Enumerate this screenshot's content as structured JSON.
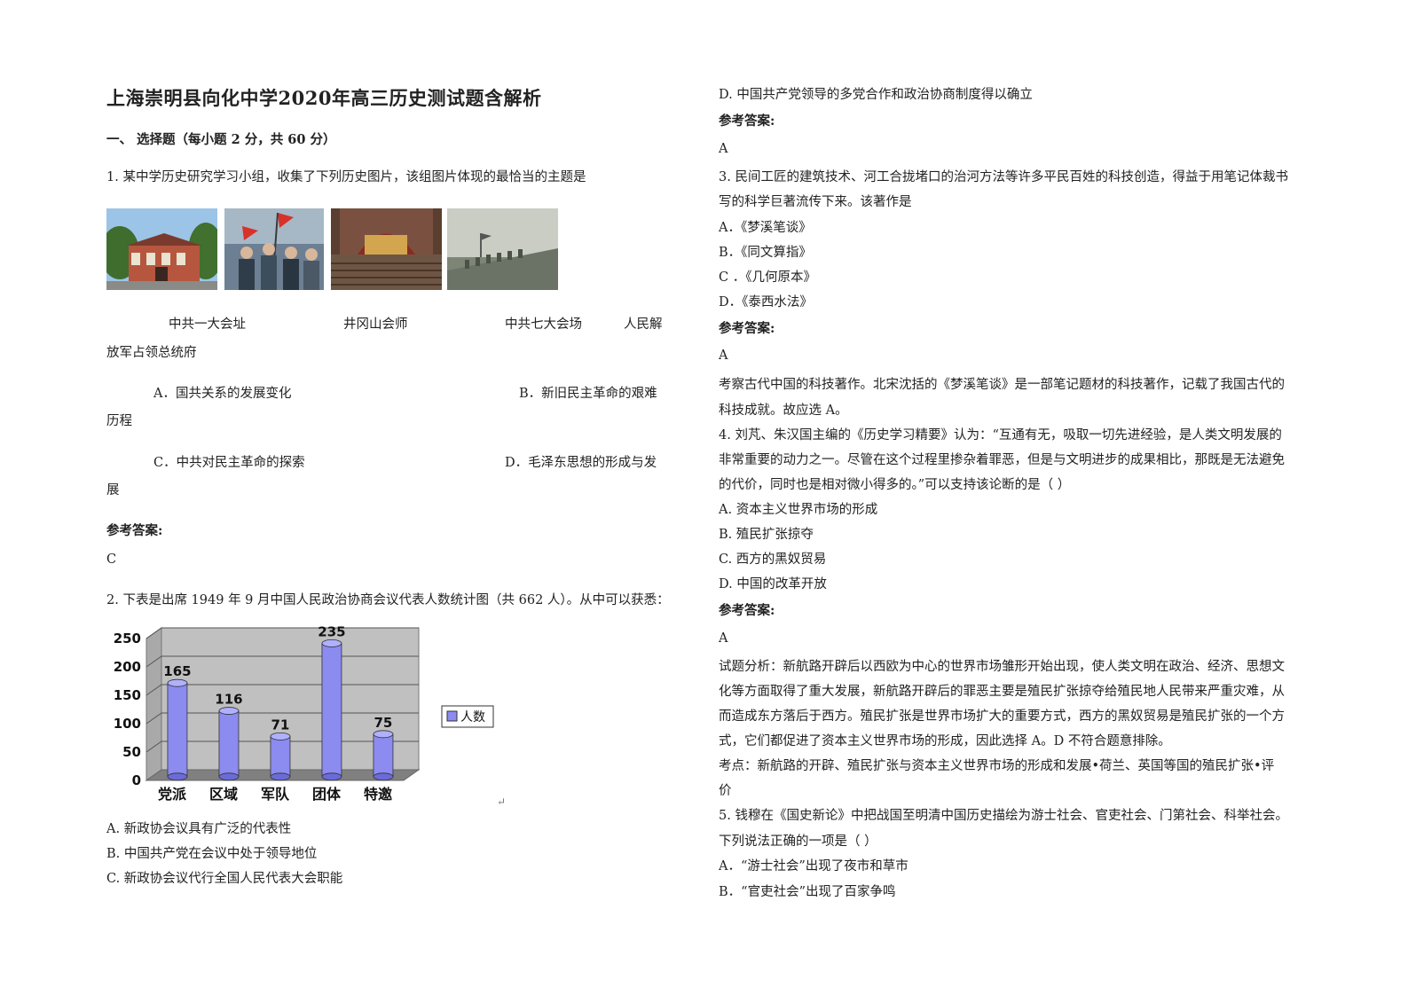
{
  "title": "上海崇明县向化中学2020年高三历史测试题含解析",
  "section": "一、 选择题（每小题 2 分，共 60 分）",
  "answer_label": "参考答案:",
  "q1": {
    "stem": "1. 某中学历史研究学习小组，收集了下列历史图片，该组图片体现的最恰当的主题是",
    "captions": [
      "中共一大会址",
      "井冈山会师",
      "中共七大会场",
      "人民解",
      "放军占领总统府"
    ],
    "options": {
      "A": "A．国共关系的发展变化",
      "B1": "B．新旧民主革命的艰难",
      "B2": "历程",
      "C": "C．中共对民主革命的探索",
      "D1": "D．毛泽东思想的形成与发",
      "D2": "展"
    },
    "answer": "C"
  },
  "q2": {
    "stem": "2. 下表是出席 1949 年 9 月中国人民政治协商会议代表人数统计图（共 662 人）。从中可以获悉：",
    "options": [
      "A. 新政协会议具有广泛的代表性",
      "B.  中国共产党在会议中处于领导地位",
      "C.  新政协会议代行全国人民代表大会职能",
      "D.  中国共产党领导的多党合作和政治协商制度得以确立"
    ],
    "answer": "A",
    "return_mark": "↵"
  },
  "chart_data": {
    "type": "bar",
    "categories": [
      "党派",
      "区域",
      "军队",
      "团体",
      "特邀"
    ],
    "values": [
      165,
      116,
      71,
      235,
      75
    ],
    "series": [
      {
        "name": "人数",
        "values": [
          165,
          116,
          71,
          235,
          75
        ]
      }
    ],
    "ylim": [
      0,
      250
    ],
    "yticks": [
      "0",
      "50",
      "100",
      "150",
      "200",
      "250"
    ],
    "grid": true,
    "legend": "right",
    "bar_color": "#8b8bf0",
    "wall_color": "#c0c0c0"
  },
  "q3": {
    "stem1": "3. 民间工匠的建筑技术、河工合拢堵口的治河方法等许多平民百姓的科技创造，得益于用笔记体裁书",
    "stem2": "写的科学巨著流传下来。该著作是",
    "options": [
      "A．《梦溪笔谈》",
      "B．《同文算指》",
      "C ．《几何原本》",
      "D．《泰西水法》"
    ],
    "answer": "A",
    "expl1": "考察古代中国的科技著作。北宋沈括的《梦溪笔谈》是一部笔记题材的科技著作，记载了我国古代的",
    "expl2": "科技成就。故应选 A。"
  },
  "q4": {
    "stem1": "4. 刘芃、朱汉国主编的《历史学习精要》认为：“互通有无，吸取一切先进经验，是人类文明发展的",
    "stem2": "非常重要的动力之一。尽管在这个过程里掺杂着罪恶，但是与文明进步的成果相比，那既是无法避免",
    "stem3": "的代价，同时也是相对微小得多的。”可以支持该论断的是（          ）",
    "options": [
      "A. 资本主义世界市场的形成",
      "B. 殖民扩张掠夺",
      "C. 西方的黑奴贸易",
      "D. 中国的改革开放"
    ],
    "answer": "A",
    "analysis": [
      "试题分析：新航路开辟后以西欧为中心的世界市场雏形开始出现，使人类文明在政治、经济、思想文",
      "化等方面取得了重大发展，新航路开辟后的罪恶主要是殖民扩张掠夺给殖民地人民带来严重灾难，从",
      "而造成东方落后于西方。殖民扩张是世界市场扩大的重要方式，西方的黑奴贸易是殖民扩张的一个方",
      "式，它们都促进了资本主义世界市场的形成，因此选择 A。D 不符合题意排除。",
      "考点：新航路的开辟、殖民扩张与资本主义世界市场的形成和发展•荷兰、英国等国的殖民扩张•评",
      "价"
    ]
  },
  "q5": {
    "stem1": "5. 钱穆在《国史新论》中把战国至明清中国历史描绘为游士社会、官吏社会、门第社会、科举社会。",
    "stem2": "下列说法正确的一项是（                ）",
    "options": [
      "A．“游士社会”出现了夜市和草市",
      "B．“官吏社会”出现了百家争鸣"
    ]
  }
}
